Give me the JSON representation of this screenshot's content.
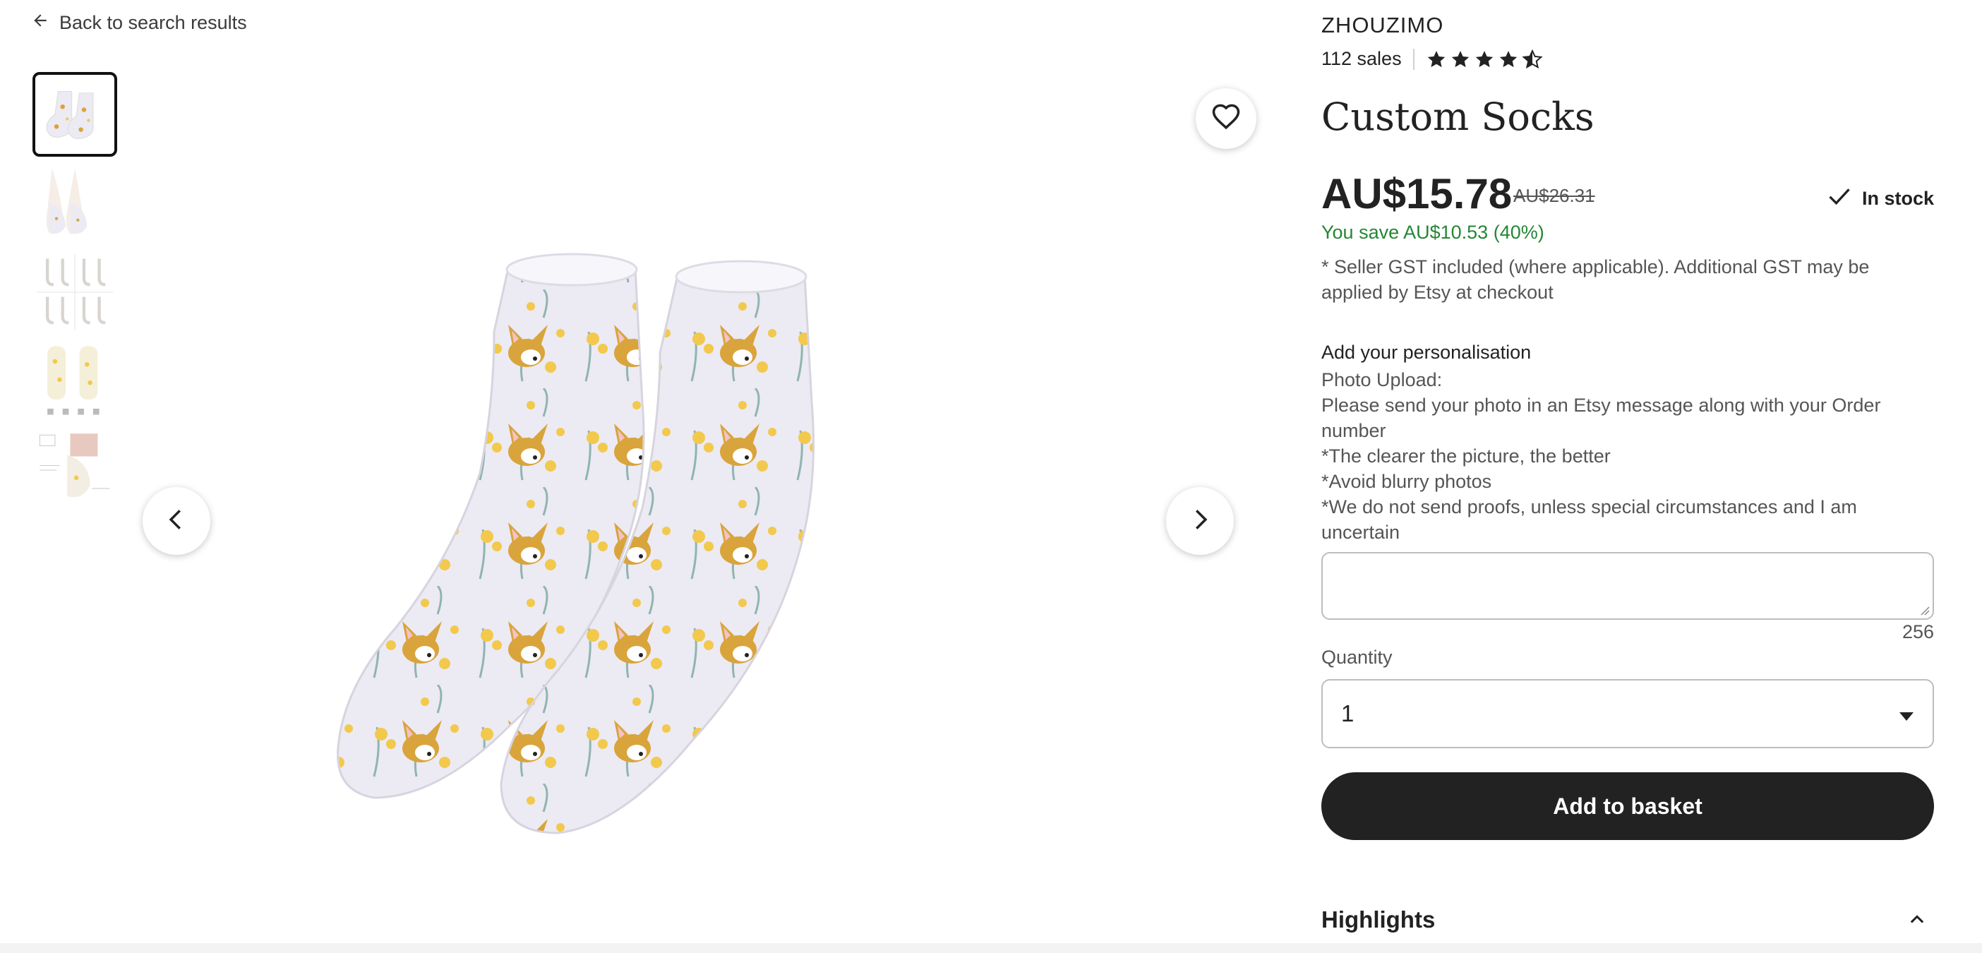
{
  "nav": {
    "back_label": "Back to search results"
  },
  "gallery": {
    "thumbnail_count": 5,
    "active_thumbnail": 1,
    "favorite_icon": "heart-icon",
    "prev_icon": "chevron-left-icon",
    "next_icon": "chevron-right-icon"
  },
  "listing": {
    "shop_name": "ZHOUZIMO",
    "sales": "112 sales",
    "rating_stars": 4.5,
    "title": "Custom Socks",
    "price": "AU$15.78",
    "original_price": "AU$26.31",
    "stock_status": "In stock",
    "savings": "You save AU$10.53 (40%)",
    "gst_note": "* Seller GST included (where applicable). Additional GST may be applied by Etsy at checkout"
  },
  "personalisation": {
    "label": "Add your personalisation",
    "lines": [
      "Photo Upload:",
      "Please send your photo in an Etsy message along with your Order number",
      "*The clearer the picture, the better",
      "*Avoid blurry photos",
      "*We do not send proofs, unless special circumstances and I am uncertain"
    ],
    "input_value": "",
    "char_count": "256"
  },
  "quantity": {
    "label": "Quantity",
    "value": "1"
  },
  "actions": {
    "add_to_basket": "Add to basket"
  },
  "sections": {
    "highlights": "Highlights"
  },
  "colors": {
    "text": "#222222",
    "secondary_text": "#555555",
    "savings_green": "#258635",
    "button_bg": "#222222",
    "sock_base": "#ECEAF3",
    "corgi_orange": "#D9A43B",
    "flower_yellow": "#F2C94C",
    "leaf_teal": "#8FB5B0"
  }
}
